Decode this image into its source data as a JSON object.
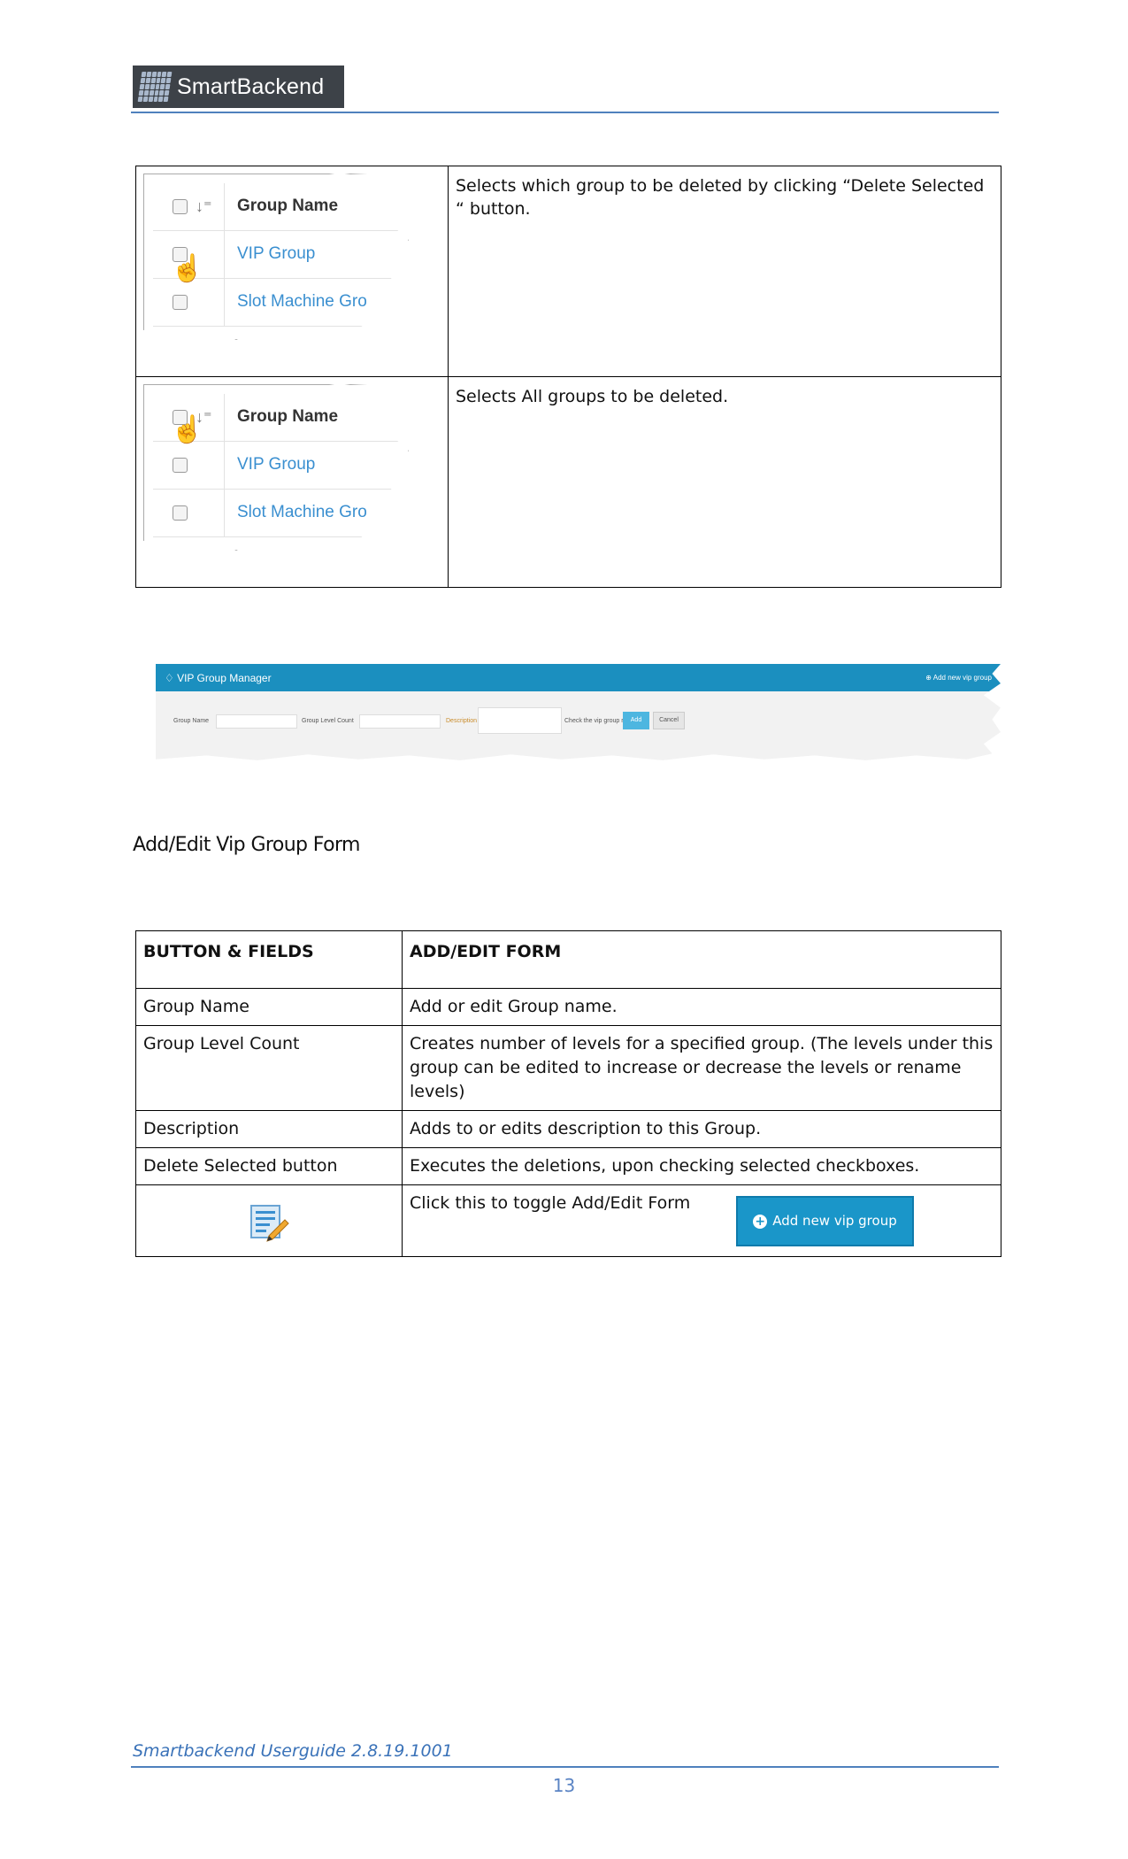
{
  "header": {
    "logo_text": "SmartBackend"
  },
  "delete_table": {
    "rows": [
      {
        "screenshot": {
          "header_label": "Group Name",
          "items": [
            "VIP Group",
            "Slot Machine Gro"
          ]
        },
        "description": "Selects which group to be deleted by clicking “Delete Selected “ button."
      },
      {
        "screenshot": {
          "header_label": "Group Name",
          "items": [
            "VIP Group",
            "Slot Machine Gro"
          ]
        },
        "description": "Selects All groups to be deleted."
      }
    ]
  },
  "vip_manager_screenshot": {
    "title": "VIP Group Manager",
    "add_link": "Add new vip group",
    "fields": [
      "Group Name",
      "Group Level Count",
      "Description",
      "Check the vip group rule"
    ],
    "add_button": "Add",
    "cancel_button": "Cancel"
  },
  "section_title": "Add/Edit Vip Group Form",
  "form_table": {
    "headers": [
      "BUTTON & FIELDS",
      "ADD/EDIT FORM"
    ],
    "rows": [
      [
        "Group Name",
        "Add or edit Group name."
      ],
      [
        "Group Level Count",
        "Creates number of levels for a specified group. (The levels under this group can be edited to increase or decrease the levels or rename levels)"
      ],
      [
        "Description",
        "Adds to or edits description to this Group."
      ],
      [
        "Delete Selected button",
        "Executes the deletions, upon checking selected checkboxes."
      ]
    ],
    "last_row": {
      "description": "Click this to toggle Add/Edit Form",
      "button_label": "Add new vip group",
      "icon": "edit-form-icon"
    }
  },
  "footer": {
    "guide_title": "Smartbackend Userguide 2.8.19.1001",
    "page_number": "13"
  },
  "colors": {
    "accent_rule": "#4f81bd",
    "vip_blue": "#1b8fbf",
    "link_blue": "#3a8fd0"
  }
}
